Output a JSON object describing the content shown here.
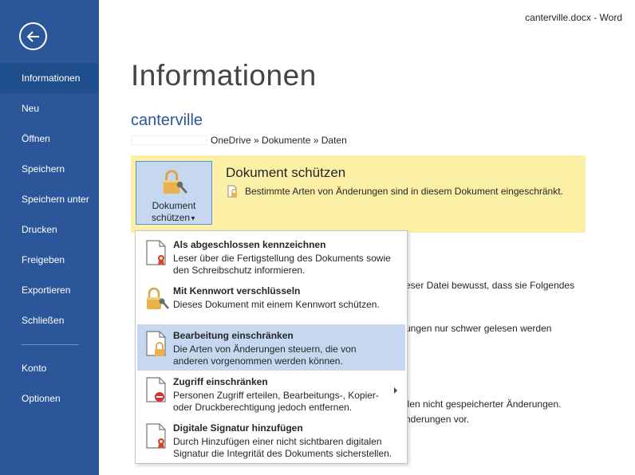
{
  "window": {
    "title": "canterville.docx - Word"
  },
  "sidebar": {
    "items": [
      {
        "label": "Informationen",
        "active": true
      },
      {
        "label": "Neu"
      },
      {
        "label": "Öffnen"
      },
      {
        "label": "Speichern"
      },
      {
        "label": "Speichern unter"
      },
      {
        "label": "Drucken"
      },
      {
        "label": "Freigeben"
      },
      {
        "label": "Exportieren"
      },
      {
        "label": "Schließen"
      },
      {
        "label": "Konto"
      },
      {
        "label": "Optionen"
      }
    ]
  },
  "page": {
    "title": "Informationen",
    "doc_name": "canterville",
    "path": "OneDrive » Dokumente » Daten"
  },
  "protect": {
    "button_line1": "Dokument",
    "button_line2": "schützen",
    "heading": "Dokument schützen",
    "description": "Bestimmte Arten von Änderungen sind in diesem Dokument eingeschränkt."
  },
  "background_text": {
    "line1": "eser Datei bewusst, dass sie Folgendes",
    "line2": "ungen nur schwer gelesen werden",
    "line3": "llen nicht gespeicherter Änderungen.",
    "line4": "nderungen vor."
  },
  "menu": {
    "items": [
      {
        "title": "Als abgeschlossen kennzeichnen",
        "desc1": "Leser über die Fertigstellung des Dokuments sowie",
        "desc2": "den Schreibschutz informieren."
      },
      {
        "title": "Mit Kennwort verschlüsseln",
        "desc1": "Dieses Dokument mit einem Kennwort schützen.",
        "desc2": ""
      },
      {
        "title": "Bearbeitung einschränken",
        "desc1": "Die Arten von Änderungen steuern, die von",
        "desc2": "anderen vorgenommen werden können.",
        "highlighted": true
      },
      {
        "title": "Zugriff einschränken",
        "desc1": "Personen Zugriff erteilen, Bearbeitungs-, Kopier-",
        "desc2": "oder Druckberechtigung jedoch entfernen.",
        "has_submenu": true
      },
      {
        "title": "Digitale Signatur hinzufügen",
        "desc1": "Durch Hinzufügen einer nicht sichtbaren digitalen",
        "desc2": "Signatur die Integrität des Dokuments sicherstellen."
      }
    ]
  },
  "colors": {
    "sidebar": "#2b579a",
    "panel": "#fcf0a7",
    "highlight": "#c5d8f0",
    "accent": "#2b579a"
  }
}
